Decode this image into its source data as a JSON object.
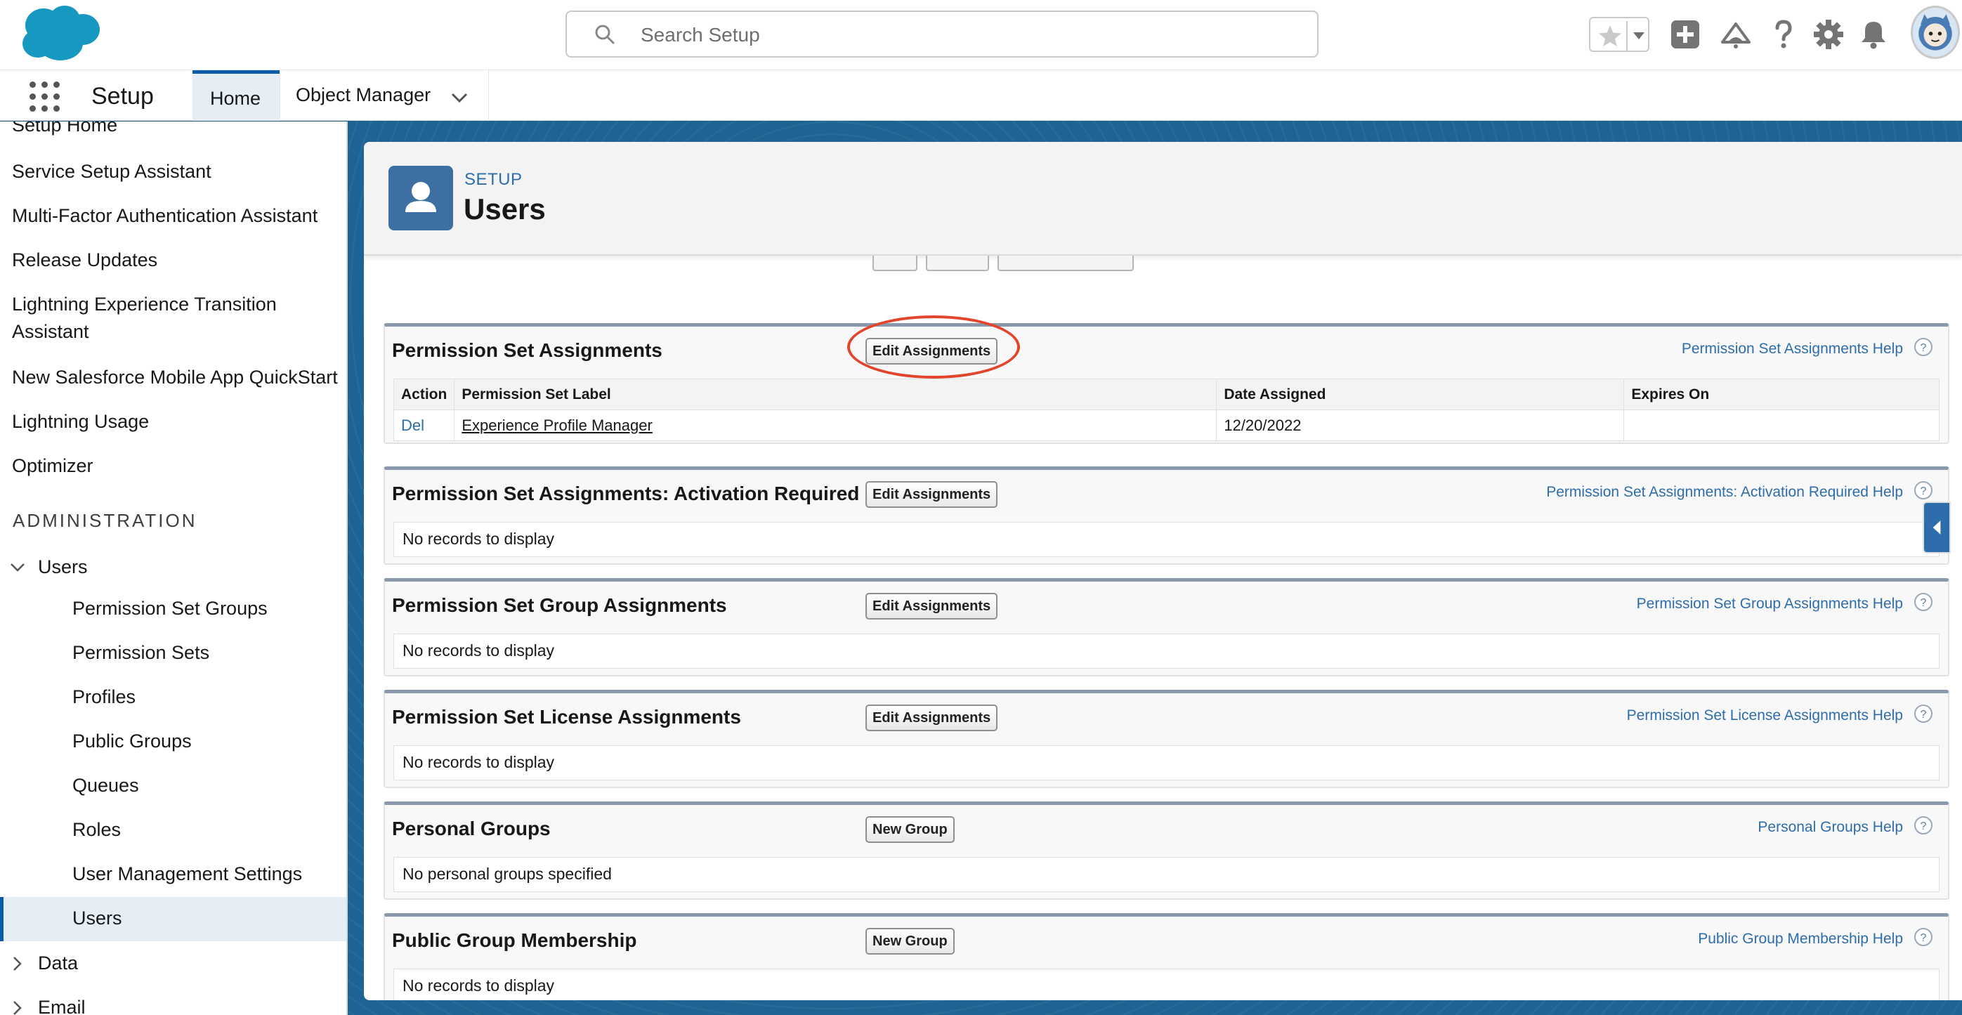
{
  "header": {
    "search_placeholder": "Search Setup",
    "icons": [
      "cloud-logo",
      "search-icon",
      "star-icon",
      "chevron-down-icon",
      "plus-icon",
      "trailhead-icon",
      "help-icon",
      "gear-icon",
      "bell-icon",
      "avatar"
    ]
  },
  "nav": {
    "app_name": "Setup",
    "tabs": [
      {
        "label": "Home"
      },
      {
        "label": "Object Manager"
      }
    ]
  },
  "sidebar": {
    "items": [
      {
        "label": "Setup Home"
      },
      {
        "label": "Service Setup Assistant"
      },
      {
        "label": "Multi-Factor Authentication Assistant"
      },
      {
        "label": "Release Updates"
      },
      {
        "label": "Lightning Experience Transition"
      },
      {
        "label": "Assistant"
      },
      {
        "label": "New Salesforce Mobile App QuickStart"
      },
      {
        "label": "Lightning Usage"
      },
      {
        "label": "Optimizer"
      }
    ],
    "section": "ADMINISTRATION",
    "users_label": "Users",
    "users_children": [
      {
        "label": "Permission Set Groups"
      },
      {
        "label": "Permission Sets"
      },
      {
        "label": "Profiles"
      },
      {
        "label": "Public Groups"
      },
      {
        "label": "Queues"
      },
      {
        "label": "Roles"
      },
      {
        "label": "User Management Settings"
      },
      {
        "label": "Users"
      }
    ],
    "data_label": "Data",
    "email_label": "Email"
  },
  "page": {
    "eyebrow": "SETUP",
    "title": "Users"
  },
  "related_lists": {
    "psa": {
      "title": "Permission Set Assignments",
      "button": "Edit Assignments",
      "help": "Permission Set Assignments Help",
      "columns": [
        "Action",
        "Permission Set Label",
        "Date Assigned",
        "Expires On"
      ],
      "rows": [
        {
          "action": "Del",
          "label": "Experience Profile Manager",
          "date": "12/20/2022",
          "expires": ""
        }
      ]
    },
    "psa_act": {
      "title": "Permission Set Assignments: Activation Required",
      "button": "Edit Assignments",
      "help": "Permission Set Assignments: Activation Required Help",
      "empty": "No records to display"
    },
    "psga": {
      "title": "Permission Set Group Assignments",
      "button": "Edit Assignments",
      "help": "Permission Set Group Assignments Help",
      "empty": "No records to display"
    },
    "psla": {
      "title": "Permission Set License Assignments",
      "button": "Edit Assignments",
      "help": "Permission Set License Assignments Help",
      "empty": "No records to display"
    },
    "pg": {
      "title": "Personal Groups",
      "button": "New Group",
      "help": "Personal Groups Help",
      "empty": "No personal groups specified"
    },
    "pgm": {
      "title": "Public Group Membership",
      "button": "New Group",
      "help": "Public Group Membership Help",
      "empty": "No records to display"
    }
  },
  "colors": {
    "brand_blue": "#0b5cab",
    "link_blue": "#2e6dab",
    "annotation_red": "#e2452c",
    "band_blue": "#1b5f8a"
  }
}
